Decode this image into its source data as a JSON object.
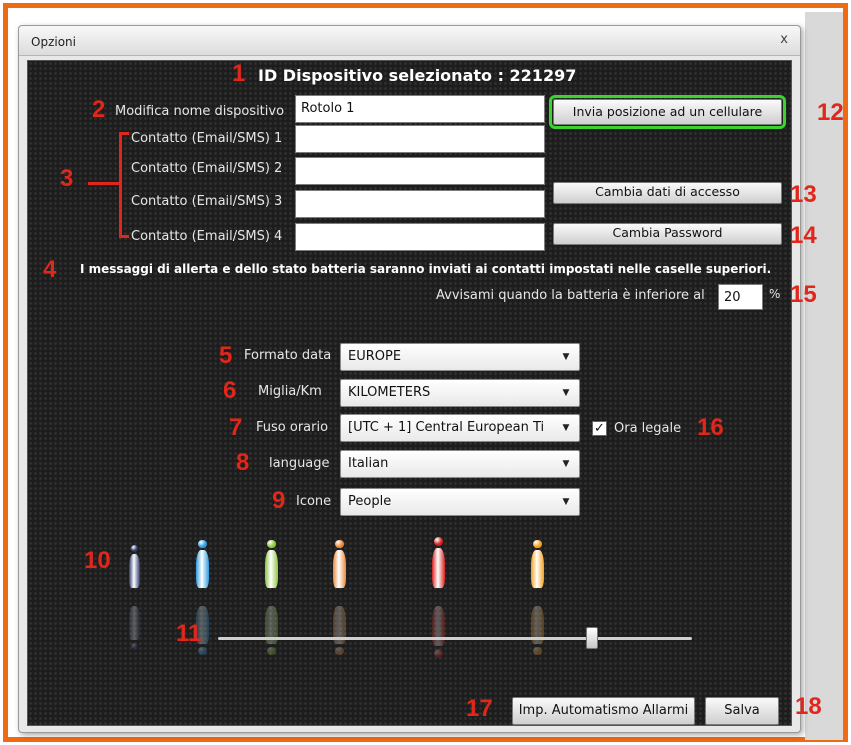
{
  "window": {
    "title": "Opzioni",
    "close_label": "x"
  },
  "device": {
    "heading": "ID Dispositivo selezionato : 221297"
  },
  "rename": {
    "label": "Modifica nome dispositivo",
    "value": "Rotolo 1"
  },
  "contacts": [
    {
      "label": "Contatto (Email/SMS) 1",
      "value": ""
    },
    {
      "label": "Contatto (Email/SMS) 2",
      "value": ""
    },
    {
      "label": "Contatto (Email/SMS) 3",
      "value": ""
    },
    {
      "label": "Contatto (Email/SMS) 4",
      "value": ""
    }
  ],
  "buttons": {
    "send_position": "Invia posizione ad un cellulare",
    "change_access": "Cambia dati di accesso",
    "change_password": "Cambia Password",
    "auto_alarm": "Imp. Automatismo Allarmi",
    "save": "Salva"
  },
  "alert_message": "I messaggi di allerta e dello stato batteria saranno inviati ai contatti impostati nelle caselle superiori.",
  "battery": {
    "label": "Avvisami quando la batteria è inferiore al",
    "value": "20",
    "unit": "%"
  },
  "settings": {
    "date_format": {
      "label": "Formato data",
      "value": "EUROPE"
    },
    "units": {
      "label": "Miglia/Km",
      "value": "KILOMETERS"
    },
    "timezone": {
      "label": "Fuso orario",
      "value": "[UTC + 1] Central European Ti"
    },
    "language": {
      "label": "language",
      "value": "Italian"
    },
    "icons": {
      "label": "Icone",
      "value": "People"
    },
    "dst": {
      "label": "Ora legale",
      "checked": true,
      "check_mark": "✓"
    }
  },
  "icon_colors": [
    "#2b3a6b",
    "#2e9be0",
    "#8cc63f",
    "#e8893a",
    "#d8201e",
    "#f4a01c"
  ],
  "slider": {
    "level": 0.79
  },
  "annotations": {
    "n1": "1",
    "n2": "2",
    "n3": "3",
    "n4": "4",
    "n5": "5",
    "n6": "6",
    "n7": "7",
    "n8": "8",
    "n9": "9",
    "n10": "10",
    "n11": "11",
    "n12": "12",
    "n13": "13",
    "n14": "14",
    "n15": "15",
    "n16": "16",
    "n17": "17",
    "n18": "18",
    "color": "#e1261c"
  }
}
